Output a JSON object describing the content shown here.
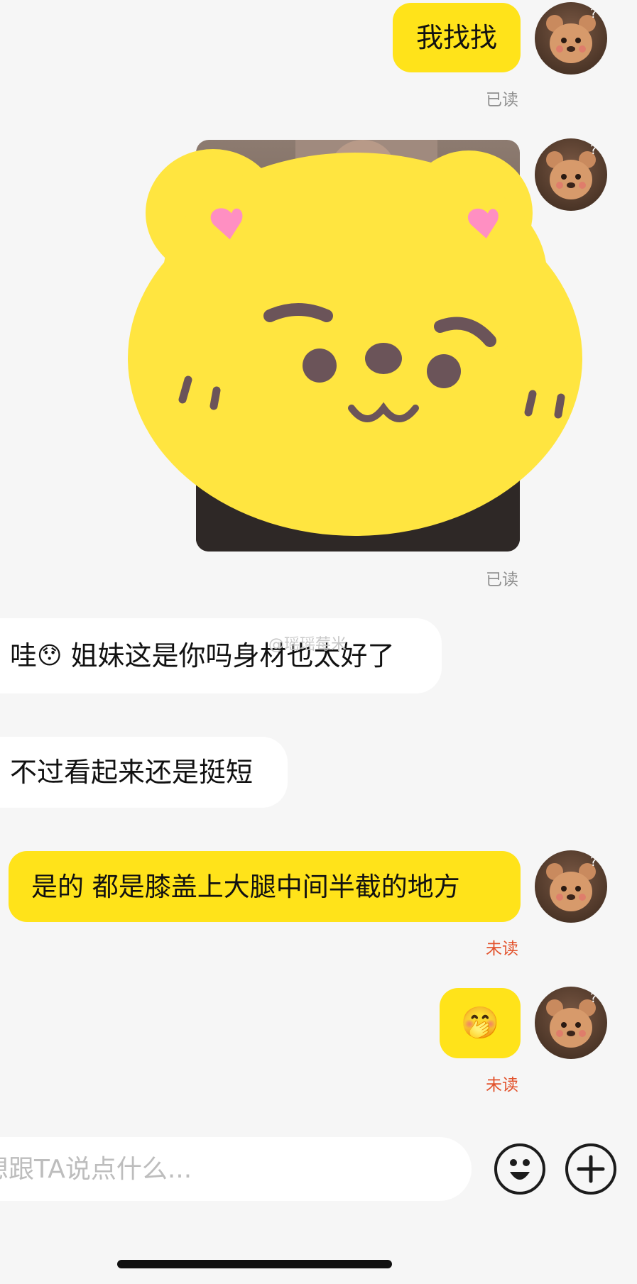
{
  "messages": [
    {
      "from": "me",
      "text": "我找找",
      "status": "已读"
    },
    {
      "from": "me",
      "type": "image",
      "status": "已读"
    },
    {
      "from": "them",
      "text_before": "哇",
      "emoji": "😯",
      "text_after": " 姐妹这是你吗身材也太好了"
    },
    {
      "from": "them",
      "text": "不过看起来还是挺短"
    },
    {
      "from": "me",
      "text": "是的 都是膝盖上大腿中间半截的地方",
      "status": "未读"
    },
    {
      "from": "me",
      "emoji": "🤭",
      "status": "未读"
    }
  ],
  "watermark": "@瑶瑶莓米",
  "input": {
    "placeholder": "想跟TA说点什么..."
  },
  "toolbar": {
    "emoji_icon": "smiley-face-icon",
    "plus_icon": "plus-icon"
  },
  "colors": {
    "my_bubble": "#ffe31a",
    "their_bubble": "#ffffff",
    "unread": "#e2522c",
    "read": "#8f8f8f",
    "background": "#f6f6f6"
  }
}
